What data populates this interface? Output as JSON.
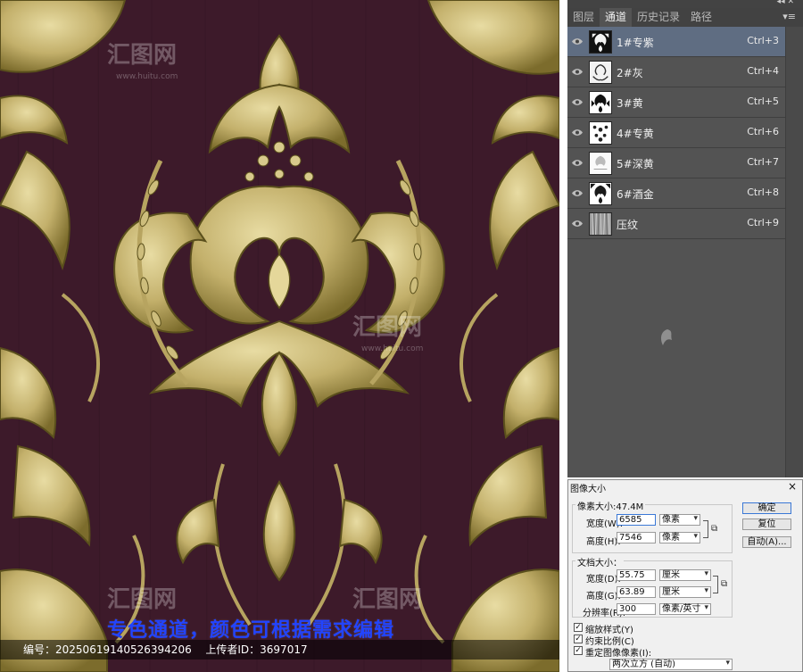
{
  "caption": "专色通道，颜色可根据需求编辑",
  "info_bar": {
    "id_label": "编号：",
    "id_value": "20250619140526394206",
    "uploader_label": "上传者ID：",
    "uploader_value": "3697017"
  },
  "watermark": {
    "text": "汇图网",
    "url": "www.huitu.com"
  },
  "panel": {
    "tabs": [
      {
        "label": "图层",
        "active": false
      },
      {
        "label": "通道",
        "active": true
      },
      {
        "label": "历史记录",
        "active": false
      },
      {
        "label": "路径",
        "active": false
      }
    ],
    "channels": [
      {
        "name": "1#专紫",
        "shortcut": "Ctrl+3",
        "selected": true
      },
      {
        "name": "2#灰",
        "shortcut": "Ctrl+4",
        "selected": false
      },
      {
        "name": "3#黄",
        "shortcut": "Ctrl+5",
        "selected": false
      },
      {
        "name": "4#专黄",
        "shortcut": "Ctrl+6",
        "selected": false
      },
      {
        "name": "5#深黄",
        "shortcut": "Ctrl+7",
        "selected": false
      },
      {
        "name": "6#酒金",
        "shortcut": "Ctrl+8",
        "selected": false
      },
      {
        "name": "压纹",
        "shortcut": "Ctrl+9",
        "selected": false
      }
    ]
  },
  "dialog": {
    "title": "图像大小",
    "close": "×",
    "pixel_dimensions": {
      "label": "像素大小:47.4M",
      "width_label": "宽度(W):",
      "width_value": "6585",
      "width_unit": "像素",
      "height_label": "高度(H):",
      "height_value": "7546",
      "height_unit": "像素"
    },
    "document_size": {
      "label": "文档大小：",
      "width_label": "宽度(D):",
      "width_value": "55.75",
      "width_unit": "厘米",
      "height_label": "高度(G):",
      "height_value": "63.89",
      "height_unit": "厘米",
      "resolution_label": "分辨率(R):",
      "resolution_value": "300",
      "resolution_unit": "像素/英寸"
    },
    "buttons": {
      "ok": "确定",
      "reset": "复位",
      "auto": "自动(A)..."
    },
    "checkboxes": [
      {
        "label": "缩放样式(Y)",
        "checked": true
      },
      {
        "label": "约束比例(C)",
        "checked": true
      },
      {
        "label": "重定图像像素(I):",
        "checked": true
      }
    ],
    "resample_method": "两次立方 (自动)"
  },
  "colors": {
    "background": "#3d1a2a",
    "gold": "#c9b878",
    "gold_dark": "#6d6128",
    "caption": "#2244ff",
    "panel": "#535353",
    "selected_row": "#5f6d82"
  }
}
